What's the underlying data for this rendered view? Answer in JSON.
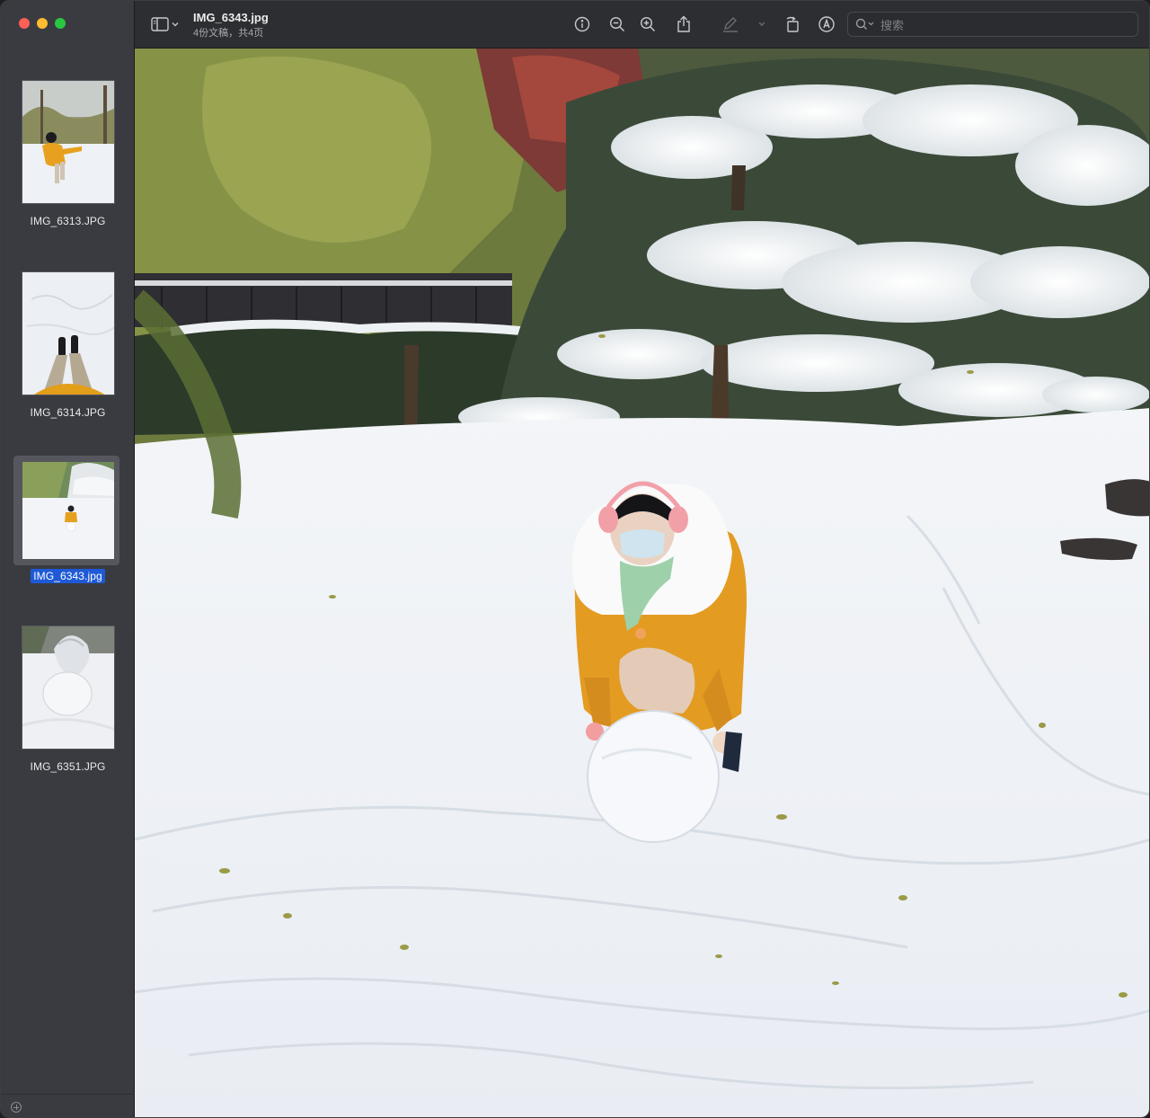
{
  "window": {
    "title": "IMG_6343.jpg",
    "subtitle": "4份文稿，共4页"
  },
  "toolbar": {
    "buttons": [
      {
        "name": "info-icon"
      },
      {
        "name": "zoom-out-icon"
      },
      {
        "name": "zoom-in-icon"
      },
      {
        "name": "share-icon"
      },
      {
        "name": "markup-icon"
      },
      {
        "name": "chevron-down-icon"
      },
      {
        "name": "rotate-icon"
      },
      {
        "name": "annotate-icon"
      }
    ],
    "search_placeholder": "搜索"
  },
  "sidebar": {
    "thumbnails": [
      {
        "label": "IMG_6313.JPG",
        "selected": false
      },
      {
        "label": "IMG_6314.JPG",
        "selected": false
      },
      {
        "label": "IMG_6343.jpg",
        "selected": true
      },
      {
        "label": "IMG_6351.JPG",
        "selected": false
      }
    ]
  },
  "colors": {
    "accent": "#1f5ad6",
    "close": "#fe5f57",
    "minimize": "#febc2e",
    "zoom": "#28c840"
  }
}
